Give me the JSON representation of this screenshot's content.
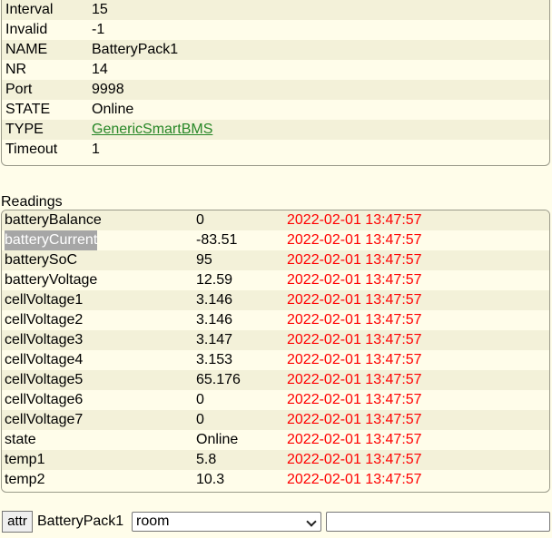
{
  "internals": {
    "rows": [
      {
        "name": "Interval",
        "value": "15"
      },
      {
        "name": "Invalid",
        "value": "-1"
      },
      {
        "name": "NAME",
        "value": "BatteryPack1"
      },
      {
        "name": "NR",
        "value": "14"
      },
      {
        "name": "Port",
        "value": "9998"
      },
      {
        "name": "STATE",
        "value": "Online"
      },
      {
        "name": "TYPE",
        "value": "GenericSmartBMS"
      },
      {
        "name": "Timeout",
        "value": "1"
      }
    ]
  },
  "readings": {
    "title": "Readings",
    "rows": [
      {
        "name": "batteryBalance",
        "value": "0",
        "time": "2022-02-01 13:47:57"
      },
      {
        "name": "batteryCurrent",
        "value": "-83.51",
        "time": "2022-02-01 13:47:57"
      },
      {
        "name": "batterySoC",
        "value": "95",
        "time": "2022-02-01 13:47:57"
      },
      {
        "name": "batteryVoltage",
        "value": "12.59",
        "time": "2022-02-01 13:47:57"
      },
      {
        "name": "cellVoltage1",
        "value": "3.146",
        "time": "2022-02-01 13:47:57"
      },
      {
        "name": "cellVoltage2",
        "value": "3.146",
        "time": "2022-02-01 13:47:57"
      },
      {
        "name": "cellVoltage3",
        "value": "3.147",
        "time": "2022-02-01 13:47:57"
      },
      {
        "name": "cellVoltage4",
        "value": "3.153",
        "time": "2022-02-01 13:47:57"
      },
      {
        "name": "cellVoltage5",
        "value": "65.176",
        "time": "2022-02-01 13:47:57"
      },
      {
        "name": "cellVoltage6",
        "value": "0",
        "time": "2022-02-01 13:47:57"
      },
      {
        "name": "cellVoltage7",
        "value": "0",
        "time": "2022-02-01 13:47:57"
      },
      {
        "name": "state",
        "value": "Online",
        "time": "2022-02-01 13:47:57"
      },
      {
        "name": "temp1",
        "value": "5.8",
        "time": "2022-02-01 13:47:57"
      },
      {
        "name": "temp2",
        "value": "10.3",
        "time": "2022-02-01 13:47:57"
      }
    ]
  },
  "attr": {
    "button_label": "attr",
    "device": "BatteryPack1",
    "selected_attribute": "room",
    "value": ""
  },
  "colors": {
    "background": "#fffdea",
    "row_alt": "#f3f1d9",
    "timestamp": "#ff0000",
    "link": "#278727",
    "selection": "#a6a6a6"
  }
}
